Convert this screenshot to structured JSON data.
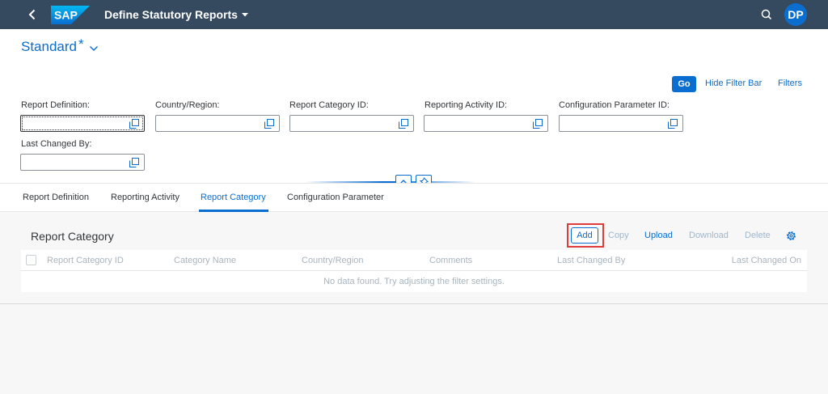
{
  "shell": {
    "logo_text": "SAP",
    "app_title": "Define Statutory Reports",
    "avatar_initials": "DP",
    "colors": {
      "shell_bg": "#354a5f",
      "accent": "#0a6ed1",
      "highlight": "#e03b3b"
    }
  },
  "variant": {
    "name": "Standard",
    "modified_marker": "*"
  },
  "filterbar": {
    "go_label": "Go",
    "hide_label": "Hide Filter Bar",
    "filters_label": "Filters",
    "fields": [
      {
        "label": "Report Definition:",
        "value": "",
        "icon": "value-help-icon"
      },
      {
        "label": "Country/Region:",
        "value": "",
        "icon": "value-help-icon"
      },
      {
        "label": "Report Category ID:",
        "value": "",
        "icon": "value-help-icon"
      },
      {
        "label": "Reporting Activity ID:",
        "value": "",
        "icon": "value-help-icon"
      },
      {
        "label": "Configuration Parameter ID:",
        "value": "",
        "icon": "value-help-icon"
      },
      {
        "label": "Last Changed By:",
        "value": "",
        "icon": "value-help-icon"
      }
    ]
  },
  "tabs": [
    {
      "label": "Report Definition",
      "active": false
    },
    {
      "label": "Reporting Activity",
      "active": false
    },
    {
      "label": "Report Category",
      "active": true
    },
    {
      "label": "Configuration Parameter",
      "active": false
    }
  ],
  "table": {
    "title": "Report Category",
    "toolbar": {
      "add": "Add",
      "copy": "Copy",
      "upload": "Upload",
      "download": "Download",
      "delete": "Delete",
      "settings_icon": "gear-icon"
    },
    "columns": [
      "Report Category ID",
      "Category Name",
      "Country/Region",
      "Comments",
      "Last Changed By",
      "Last Changed On"
    ],
    "rows": [],
    "no_data_text": "No data found. Try adjusting the filter settings."
  }
}
